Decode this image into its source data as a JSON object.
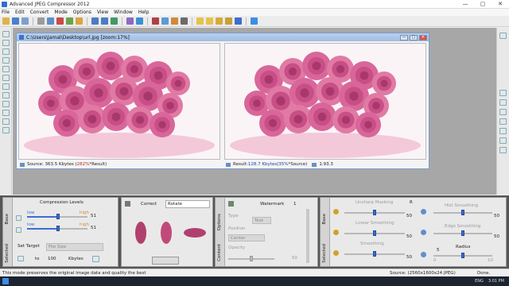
{
  "app": {
    "title": "Advanced JPEG Compressor 2012",
    "controls": [
      "—",
      "▢",
      "✕"
    ]
  },
  "menu": [
    "File",
    "Edit",
    "Convert",
    "Mode",
    "Options",
    "View",
    "Window",
    "Help"
  ],
  "document": {
    "title": "C:\\Users\\Jamal\\Desktop\\url.jpg [zoom:17%]",
    "source_status": {
      "prefix": "Source: 363.5 Kbytes (",
      "pct": "282%",
      "suffix": "*Result)"
    },
    "result_status": {
      "prefix": "Result: ",
      "size": "128.7 Kbytes",
      "mid": " (",
      "pct": "35%",
      "suffix": "*Source)"
    },
    "ratio": "1:93.3"
  },
  "compression_panel": {
    "tab": "Base",
    "tab2": "Selected",
    "title": "Compression Levels",
    "q1_value": "51",
    "q2_value": "51",
    "low_label_1": "low",
    "high_label_1": "high",
    "low_label_2": "low",
    "high_label_2": "high",
    "set_target_label": "Set Target",
    "file_size_placeholder": "File Size",
    "to_label": "to",
    "to_value": "100",
    "unit_label": "Kbytes"
  },
  "correct_panel": {
    "title": "Correct",
    "rotate_value": "Rotate"
  },
  "watermark_panel": {
    "tab": "Options",
    "tab2": "Content",
    "title": "Watermark",
    "count": "1",
    "type_label": "Type",
    "type_value": "Text",
    "position_label": "Position",
    "position_value": "Center",
    "opacity_label": "Opacity",
    "opacity_value": "50"
  },
  "fx_panel": {
    "tab": "Base",
    "tab2": "Selected",
    "groups": [
      {
        "name": "Unsharp Masking",
        "value": "50"
      },
      {
        "name": "Linear Smoothing",
        "value": "50"
      },
      {
        "name": "Smoothing",
        "value": "50"
      },
      {
        "name": "Hist Smoothing",
        "value": "50"
      },
      {
        "name": "Edge Smoothing",
        "value": "50"
      }
    ],
    "r_label": "R",
    "radius_label": "Radius",
    "radius_value": "5",
    "radius_min": "0",
    "radius_max": "10"
  },
  "statusbar": {
    "left": "This mode preserves the original image data and quality the best",
    "middle": "Source: (2560x1600x24 JPEG)",
    "right": "Done."
  },
  "taskbar": {
    "lang": "ENG",
    "time": "3:01 PM"
  },
  "colors": {
    "accent": "#3b6fcf",
    "red": "#c81e1e",
    "blue": "#1a3fb0",
    "workspace": "#a7a7a7"
  }
}
